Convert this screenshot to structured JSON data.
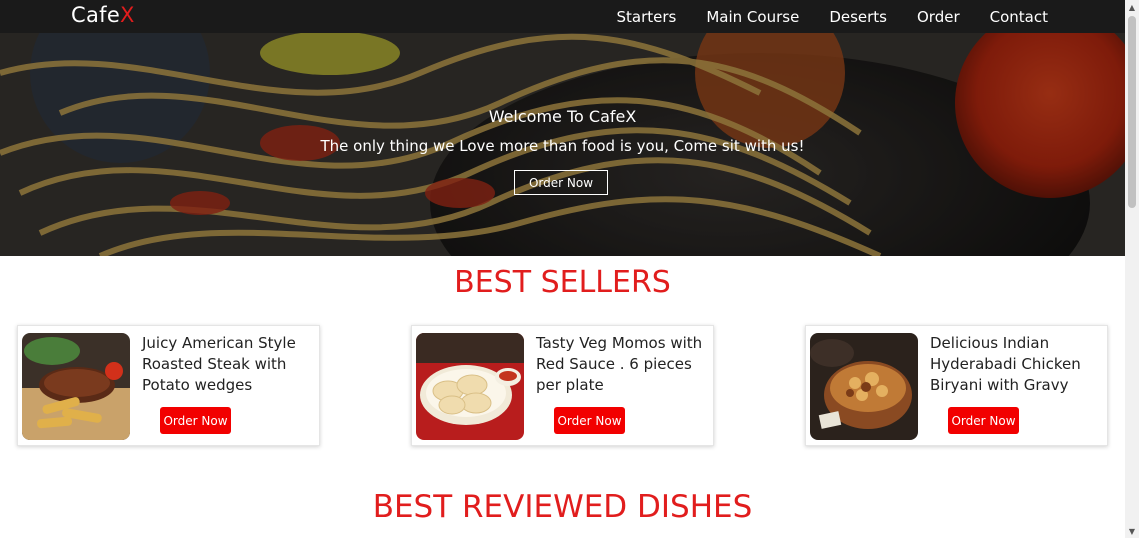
{
  "navbar": {
    "logo_main": "Cafe",
    "logo_accent": "X",
    "links": [
      "Starters",
      "Main Course",
      "Deserts",
      "Order",
      "Contact"
    ]
  },
  "hero": {
    "title": "Welcome To CafeX",
    "subtitle": "The only thing we Love more than food is you, Come sit with us!",
    "button": "Order Now"
  },
  "best_sellers": {
    "title": "BEST SELLERS",
    "cards": [
      {
        "text": "Juicy American Style Roasted Steak with Potato wedges",
        "button": "Order Now",
        "image": "steak-image"
      },
      {
        "text": "Tasty Veg Momos with Red Sauce . 6 pieces per plate",
        "button": "Order Now",
        "image": "momos-image"
      },
      {
        "text": "Delicious Indian Hyderabadi Chicken Biryani with Gravy",
        "button": "Order Now",
        "image": "biryani-image"
      }
    ]
  },
  "best_reviewed": {
    "title": "BEST REVIEWED DISHES"
  },
  "colors": {
    "accent": "#e11d1d",
    "button_red": "#f20000",
    "navbar_bg": "#1a1a1a"
  }
}
